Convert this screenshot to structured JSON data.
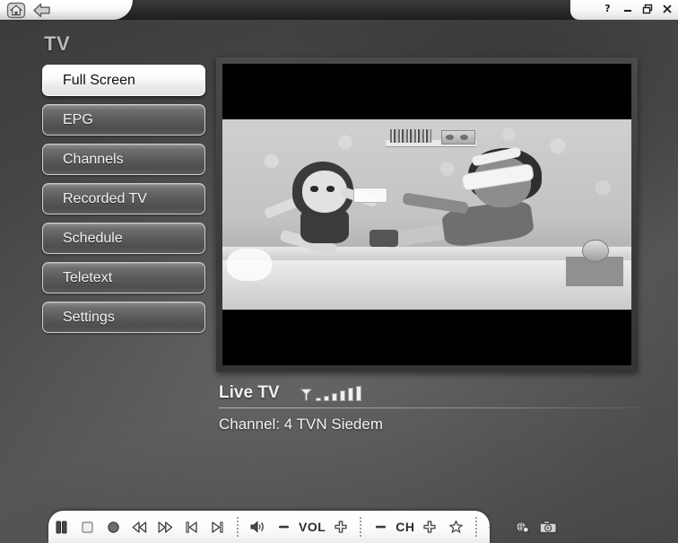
{
  "window": {
    "nav": {
      "home": "home-icon",
      "back": "back-arrow-icon"
    },
    "controls": {
      "help": "?",
      "minimize": "minimize-icon",
      "restore": "restore-icon",
      "close": "close-icon"
    }
  },
  "sidebar": {
    "title": "TV",
    "items": [
      {
        "label": "Full Screen",
        "selected": true
      },
      {
        "label": "EPG",
        "selected": false
      },
      {
        "label": "Channels",
        "selected": false
      },
      {
        "label": "Recorded TV",
        "selected": false
      },
      {
        "label": "Schedule",
        "selected": false
      },
      {
        "label": "Teletext",
        "selected": false
      },
      {
        "label": "Settings",
        "selected": false
      }
    ]
  },
  "video": {
    "state": "playing"
  },
  "nowplaying": {
    "title": "Live TV",
    "signal_icon": "antenna-icon",
    "signal_bars": 6,
    "signal_level": 6,
    "channel": "Channel: 4 TVN Siedem"
  },
  "controlbar": {
    "transport": [
      {
        "name": "pause-button",
        "icon": "pause-icon"
      },
      {
        "name": "stop-button",
        "icon": "stop-icon"
      },
      {
        "name": "record-button",
        "icon": "record-icon"
      },
      {
        "name": "rewind-button",
        "icon": "rewind-icon"
      },
      {
        "name": "fast-forward-button",
        "icon": "fast-forward-icon"
      },
      {
        "name": "previous-button",
        "icon": "skip-back-icon"
      },
      {
        "name": "next-button",
        "icon": "skip-forward-icon"
      }
    ],
    "volume": {
      "mute_icon": "speaker-icon",
      "minus": "−",
      "label": "VOL",
      "plus": "+"
    },
    "channel": {
      "minus": "−",
      "label": "CH",
      "plus": "+",
      "favorite_icon": "star-icon"
    },
    "extras": [
      {
        "name": "dpad-button",
        "icon": "dpad-icon"
      },
      {
        "name": "info-button",
        "icon": "globe-search-icon"
      },
      {
        "name": "snapshot-button",
        "icon": "camera-icon"
      }
    ]
  },
  "colors": {
    "background_dark": "#3b3b3b",
    "background_light": "#565656",
    "selected_button": "#ffffff",
    "button_gray": "#5a5a5a",
    "text_light": "#f2f2f2",
    "titlebar": "#1e1e1e"
  }
}
